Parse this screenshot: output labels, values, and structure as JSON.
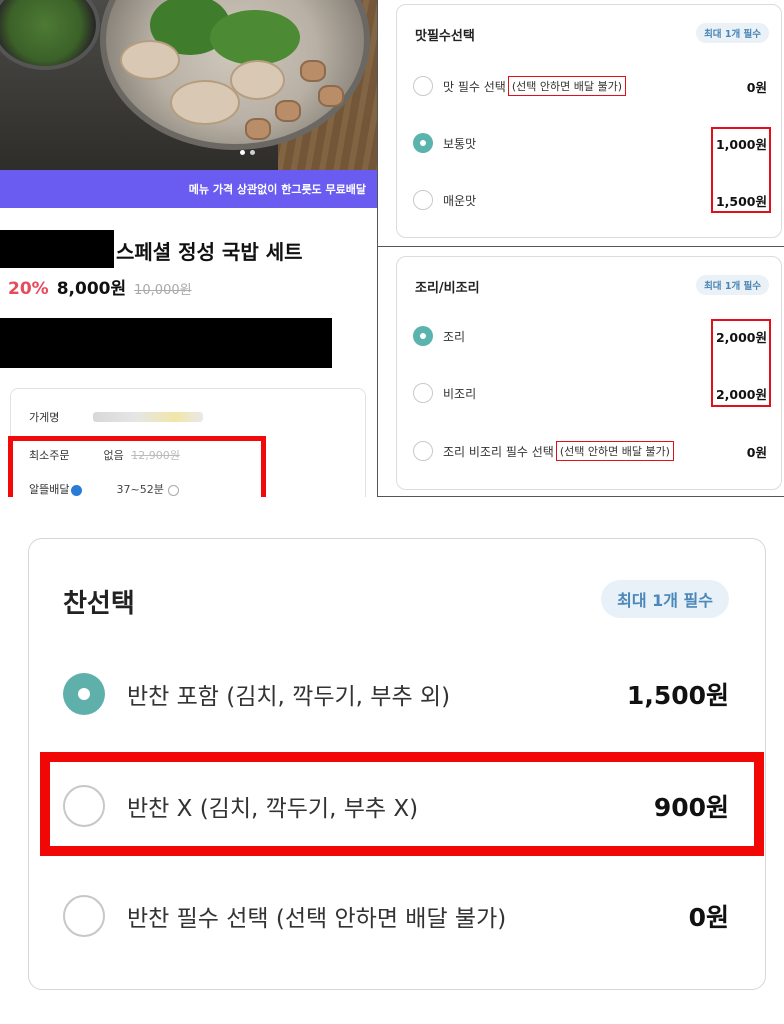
{
  "product": {
    "banner": "메뉴 가격 상관없이 한그릇도 무료배달",
    "title": "스페셜 정성 국밥 세트",
    "discount": "20%",
    "price": "8,000원",
    "original_price": "10,000원"
  },
  "store_info": {
    "store_name_label": "가게명",
    "min_order_label": "최소주문",
    "min_order_value": "없음",
    "min_order_original": "12,900원",
    "delivery_label": "알뜰배달",
    "delivery_time": "37~52분"
  },
  "taste_card": {
    "title": "맛필수선택",
    "badge": "최대 1개 필수",
    "options": [
      {
        "label": "맛 필수 선택",
        "note": "(선택 안하면 배달 불가)",
        "price": "0원",
        "selected": false
      },
      {
        "label": "보통맛",
        "note": "",
        "price": "1,000원",
        "selected": true
      },
      {
        "label": "매운맛",
        "note": "",
        "price": "1,500원",
        "selected": false
      }
    ]
  },
  "cook_card": {
    "title": "조리/비조리",
    "badge": "최대 1개 필수",
    "options": [
      {
        "label": "조리",
        "note": "",
        "price": "2,000원",
        "selected": true
      },
      {
        "label": "비조리",
        "note": "",
        "price": "2,000원",
        "selected": false
      },
      {
        "label": "조리 비조리 필수 선택",
        "note": "(선택 안하면 배달 불가)",
        "price": "0원",
        "selected": false
      }
    ]
  },
  "side_card": {
    "title": "찬선택",
    "badge": "최대 1개 필수",
    "options": [
      {
        "label": "반찬 포함 (김치, 깍두기, 부추 외)",
        "price": "1,500원",
        "selected": true
      },
      {
        "label": "반찬 X (김치, 깍두기, 부추 X)",
        "price": "900원",
        "selected": false
      },
      {
        "label": "반찬 필수 선택 (선택 안하면 배달 불가)",
        "price": "0원",
        "selected": false
      }
    ]
  },
  "colors": {
    "accent_teal": "#5bb3ad",
    "banner_purple": "#6a5cf0",
    "highlight_red": "#f20707",
    "discount_red": "#e8495b",
    "badge_blue": "#4a86b5"
  }
}
